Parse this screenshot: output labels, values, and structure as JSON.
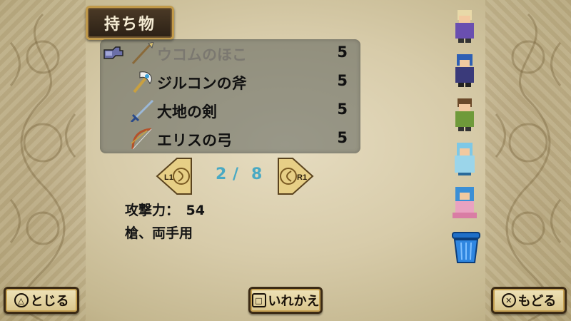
{
  "header": {
    "title": "持ち物"
  },
  "items": [
    {
      "name": "ウコムのほこ",
      "qty": "5",
      "icon": "spear-icon",
      "selected": true,
      "disabled": true
    },
    {
      "name": "ジルコンの斧",
      "qty": "5",
      "icon": "axe-icon",
      "selected": false,
      "disabled": false
    },
    {
      "name": "大地の剣",
      "qty": "5",
      "icon": "sword-icon",
      "selected": false,
      "disabled": false
    },
    {
      "name": "エリスの弓",
      "qty": "5",
      "icon": "bow-icon",
      "selected": false,
      "disabled": false
    }
  ],
  "pager": {
    "current": "2",
    "separator": "/",
    "total": "8",
    "prev_label": "L1",
    "next_label": "R1"
  },
  "stats": {
    "attack_line": "攻撃力：　54",
    "type_line": "槍、両手用"
  },
  "party": [
    {
      "name": "party-member-1",
      "hair": "#e8d9a8",
      "outfit": "#6a4fb0"
    },
    {
      "name": "party-member-2",
      "hair": "#2d5fb4",
      "outfit": "#3a3a7a"
    },
    {
      "name": "party-member-3",
      "hair": "#6b4a2a",
      "outfit": "#6f9a3a"
    },
    {
      "name": "party-member-4",
      "hair": "#7ec8e6",
      "outfit": "#9bd5ea"
    },
    {
      "name": "party-member-5",
      "hair": "#3b8fd6",
      "outfit": "#e9a2c0"
    }
  ],
  "buttons": {
    "close_glyph": "△",
    "close_label": "とじる",
    "swap_glyph": "□",
    "swap_label": "いれかえ",
    "back_glyph": "✕",
    "back_label": "もどる"
  },
  "colors": {
    "page_number": "#49a9c3",
    "panel_border": "#c19a4a"
  }
}
